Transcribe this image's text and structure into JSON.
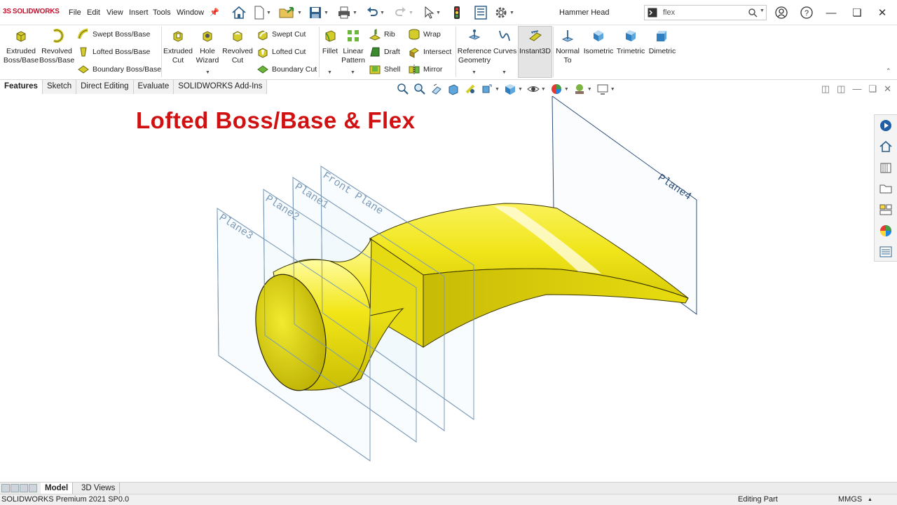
{
  "app": {
    "logo_ds": "3S",
    "logo_text": "SOLIDWORKS",
    "menu": [
      "File",
      "Edit",
      "View",
      "Insert",
      "Tools",
      "Window"
    ],
    "document_title": "Hammer Head",
    "search_value": "flex"
  },
  "ribbon": {
    "extruded_boss": "Extruded\nBoss/Base",
    "revolved_boss": "Revolved\nBoss/Base",
    "swept_boss": "Swept Boss/Base",
    "lofted_boss": "Lofted Boss/Base",
    "boundary_boss": "Boundary Boss/Base",
    "extruded_cut": "Extruded\nCut",
    "hole_wizard": "Hole\nWizard",
    "revolved_cut": "Revolved\nCut",
    "swept_cut": "Swept Cut",
    "lofted_cut": "Lofted Cut",
    "boundary_cut": "Boundary Cut",
    "fillet": "Fillet",
    "linear_pattern": "Linear\nPattern",
    "rib": "Rib",
    "draft": "Draft",
    "shell": "Shell",
    "wrap": "Wrap",
    "intersect": "Intersect",
    "mirror": "Mirror",
    "reference_geometry": "Reference\nGeometry",
    "curves": "Curves",
    "instant3d": "Instant3D",
    "normal_to": "Normal\nTo",
    "isometric": "Isometric",
    "trimetric": "Trimetric",
    "dimetric": "Dimetric"
  },
  "tabs": [
    "Features",
    "Sketch",
    "Direct Editing",
    "Evaluate",
    "SOLIDWORKS Add-Ins"
  ],
  "viewport": {
    "heading": "Lofted Boss/Base & Flex",
    "planes": [
      "Plane3",
      "Plane2",
      "Plane1",
      "Front Plane",
      "Plane4"
    ]
  },
  "bottom_tabs": [
    "Model",
    "3D Views"
  ],
  "status": {
    "version": "SOLIDWORKS Premium 2021 SP0.0",
    "mode": "Editing Part",
    "units": "MMGS"
  },
  "colors": {
    "accent": "#d11111",
    "part_yellow": "#f2ea1c"
  }
}
